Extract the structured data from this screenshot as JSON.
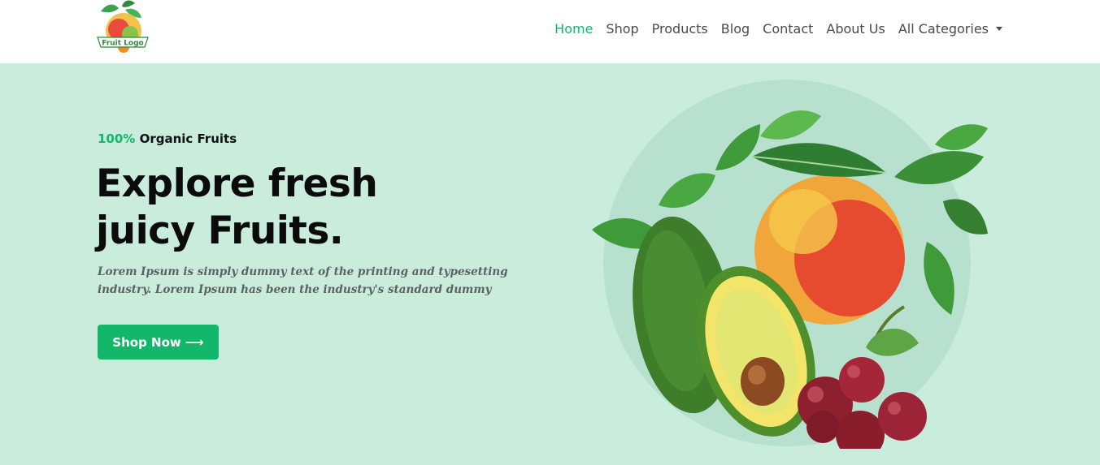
{
  "logo": {
    "text": "Fruit Logo",
    "icon": "fruit-logo-icon"
  },
  "nav": {
    "items": [
      {
        "label": "Home",
        "active": true
      },
      {
        "label": "Shop"
      },
      {
        "label": "Products"
      },
      {
        "label": "Blog"
      },
      {
        "label": "Contact"
      },
      {
        "label": "About Us"
      },
      {
        "label": "All Categories",
        "dropdown": true
      }
    ]
  },
  "hero": {
    "eyebrow_accent": "100%",
    "eyebrow_text": "Organic Fruits",
    "headline_line1": "Explore fresh",
    "headline_line2": "juicy Fruits.",
    "lead": "Lorem Ipsum is simply dummy text of the printing and typesetting industry. Lorem Ipsum has been the industry's standard dummy",
    "cta_label": "Shop Now",
    "cta_icon": "arrow-right-icon",
    "image": "fruit-illustration"
  },
  "colors": {
    "accent": "#12b76a",
    "hero_bg": "#c9ecdd",
    "hero_circle": "#b6dfcd",
    "nav_text": "#4a4a4a",
    "headline": "#0b0b0b"
  }
}
